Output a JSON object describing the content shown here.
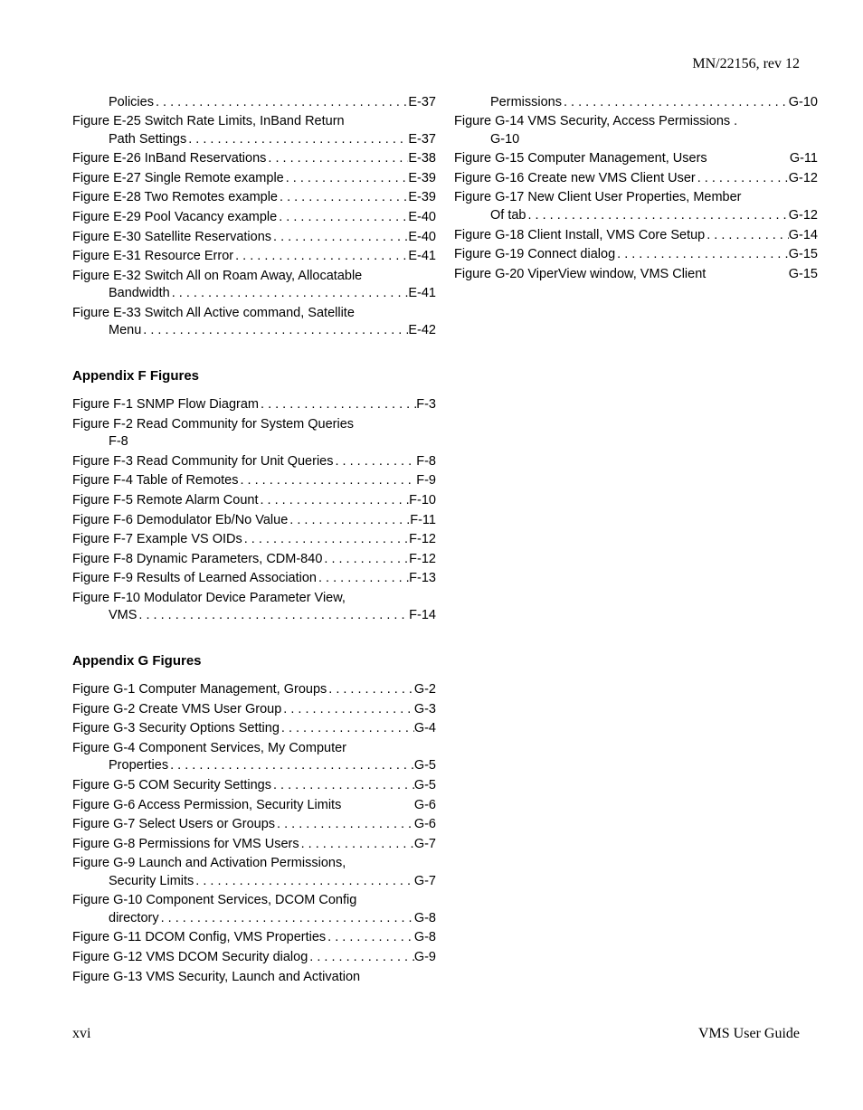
{
  "header": {
    "doc_id": "MN/22156, rev 12"
  },
  "footer": {
    "page": "xvi",
    "title": "VMS User Guide"
  },
  "left_col": {
    "appE_cont": [
      {
        "type": "cont",
        "text": "Policies",
        "page": "E-37",
        "indent": true
      },
      {
        "type": "multi",
        "prefix": "Figure E-25",
        "text": "Switch Rate Limits, InBand Return",
        "cont": "Path Settings",
        "page": "E-37"
      },
      {
        "type": "single",
        "prefix": "Figure E-26",
        "text": "InBand Reservations",
        "page": "E-38"
      },
      {
        "type": "single",
        "prefix": "Figure E-27",
        "text": "Single Remote example",
        "page": "E-39"
      },
      {
        "type": "single",
        "prefix": "Figure E-28",
        "text": "Two Remotes example",
        "page": "E-39"
      },
      {
        "type": "single",
        "prefix": "Figure E-29",
        "text": "Pool Vacancy example",
        "page": "E-40"
      },
      {
        "type": "single",
        "prefix": "Figure E-30",
        "text": "Satellite Reservations",
        "page": "E-40"
      },
      {
        "type": "single",
        "prefix": "Figure E-31",
        "text": "Resource Error",
        "page": "E-41"
      },
      {
        "type": "multi",
        "prefix": "Figure E-32",
        "text": "Switch All on Roam Away, Allocatable",
        "cont": "Bandwidth",
        "page": "E-41"
      },
      {
        "type": "multi",
        "prefix": "Figure E-33",
        "text": "Switch All Active command, Satellite",
        "cont": "Menu",
        "page": "E-42"
      }
    ],
    "appF_title": "Appendix F Figures",
    "appF": [
      {
        "type": "single",
        "prefix": "Figure F-1",
        "text": "SNMP Flow Diagram",
        "page": "F-3"
      },
      {
        "type": "multi_below",
        "prefix": "Figure F-2",
        "text": "Read Community for System Queries",
        "page": "F-8"
      },
      {
        "type": "single",
        "prefix": "Figure F-3",
        "text": "Read Community for Unit Queries",
        "page": "F-8"
      },
      {
        "type": "single",
        "prefix": "Figure F-4",
        "text": "Table of Remotes",
        "page": "F-9"
      },
      {
        "type": "single",
        "prefix": "Figure F-5",
        "text": "Remote Alarm Count",
        "page": "F-10"
      },
      {
        "type": "single",
        "prefix": "Figure F-6",
        "text": "Demodulator Eb/No Value",
        "page": "F-11"
      },
      {
        "type": "single",
        "prefix": "Figure F-7",
        "text": "Example VS OIDs",
        "page": "F-12"
      },
      {
        "type": "single",
        "prefix": "Figure F-8",
        "text": "Dynamic Parameters, CDM-840",
        "page": "F-12"
      },
      {
        "type": "single",
        "prefix": "Figure F-9",
        "text": "Results of Learned Association",
        "page": "F-13"
      },
      {
        "type": "multi",
        "prefix": "Figure F-10",
        "text": "Modulator Device Parameter View,",
        "cont": "VMS",
        "page": "F-14"
      }
    ],
    "appG_title": "Appendix G Figures",
    "appG": [
      {
        "type": "single",
        "prefix": "Figure G-1",
        "text": "Computer Management, Groups",
        "page": "G-2"
      },
      {
        "type": "single",
        "prefix": "Figure G-2",
        "text": "Create VMS User Group",
        "page": "G-3"
      },
      {
        "type": "single",
        "prefix": "Figure G-3",
        "text": "Security Options Setting",
        "page": "G-4"
      },
      {
        "type": "multi",
        "prefix": "Figure G-4",
        "text": "Component Services, My Computer",
        "cont": "Properties",
        "page": "G-5"
      },
      {
        "type": "single",
        "prefix": "Figure G-5",
        "text": "COM Security Settings",
        "page": "G-5"
      },
      {
        "type": "nodots",
        "prefix": "Figure G-6",
        "text": "Access Permission, Security Limits",
        "page": "G-6"
      },
      {
        "type": "single",
        "prefix": "Figure G-7",
        "text": "Select Users or Groups",
        "page": "G-6"
      },
      {
        "type": "single",
        "prefix": "Figure G-8",
        "text": "Permissions for VMS Users",
        "page": "G-7"
      },
      {
        "type": "multi",
        "prefix": "Figure G-9",
        "text": "Launch and Activation Permissions,",
        "cont": "Security Limits",
        "page": "G-7"
      },
      {
        "type": "multi",
        "prefix": "Figure G-10",
        "text": "Component Services, DCOM Config",
        "cont": "directory",
        "page": "G-8"
      },
      {
        "type": "single",
        "prefix": "Figure G-11",
        "text": "DCOM Config, VMS Properties",
        "page": "G-8"
      },
      {
        "type": "single",
        "prefix": "Figure G-12",
        "text": "VMS DCOM Security dialog",
        "page": "G-9"
      },
      {
        "type": "open",
        "prefix": "Figure G-13",
        "text": "VMS Security, Launch and Activation"
      }
    ]
  },
  "right_col": {
    "cont_first": [
      {
        "type": "cont",
        "text": "Permissions",
        "page": "G-10",
        "indent": true
      },
      {
        "type": "multi_below",
        "prefix": "Figure G-14",
        "text": "VMS Security, Access Permissions .",
        "page": "G-10"
      },
      {
        "type": "nodots_sp",
        "prefix": "Figure G-15",
        "text": "Computer Management, Users",
        "page": "G-11"
      },
      {
        "type": "single",
        "prefix": "Figure G-16",
        "text": "Create new VMS Client User",
        "page": "G-12"
      },
      {
        "type": "multi",
        "prefix": "Figure G-17",
        "text": "New Client User Properties, Member",
        "cont": "Of tab",
        "page": "G-12"
      },
      {
        "type": "single",
        "prefix": "Figure G-18",
        "text": "Client Install, VMS Core Setup",
        "page": "G-14"
      },
      {
        "type": "single",
        "prefix": "Figure G-19",
        "text": "Connect dialog",
        "page": "G-15"
      },
      {
        "type": "nodots_sp",
        "prefix": "Figure G-20",
        "text": "ViperView window, VMS Client",
        "page": "G-15"
      }
    ]
  }
}
